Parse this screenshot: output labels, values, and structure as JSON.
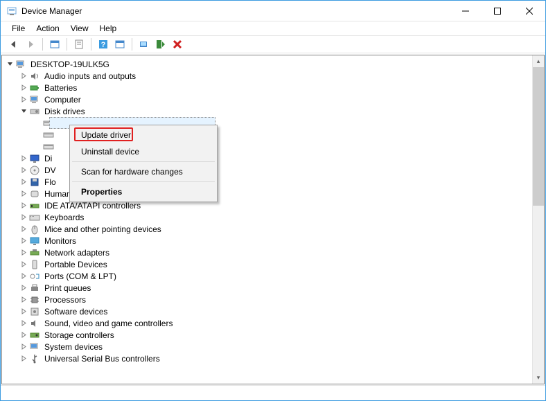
{
  "title": "Device Manager",
  "menubar": [
    "File",
    "Action",
    "View",
    "Help"
  ],
  "toolbar_icons": [
    "back",
    "forward",
    "show-hidden",
    "properties",
    "help",
    "scan",
    "monitor",
    "update",
    "delete"
  ],
  "root": "DESKTOP-19ULK5G",
  "nodes": [
    {
      "label": "Audio inputs and outputs",
      "expanded": false,
      "indent": 1,
      "icon": "audio"
    },
    {
      "label": "Batteries",
      "expanded": false,
      "indent": 1,
      "icon": "battery"
    },
    {
      "label": "Computer",
      "expanded": false,
      "indent": 1,
      "icon": "computer"
    },
    {
      "label": "Disk drives",
      "expanded": true,
      "indent": 1,
      "icon": "disk"
    },
    {
      "label": "",
      "expanded": null,
      "indent": 2,
      "icon": "drive",
      "selected": true
    },
    {
      "label": "",
      "expanded": null,
      "indent": 2,
      "icon": "drive"
    },
    {
      "label": "",
      "expanded": null,
      "indent": 2,
      "icon": "drive"
    },
    {
      "label": "Di",
      "expanded": false,
      "indent": 1,
      "icon": "display"
    },
    {
      "label": "DV",
      "expanded": false,
      "indent": 1,
      "icon": "dvd"
    },
    {
      "label": "Flo",
      "expanded": false,
      "indent": 1,
      "icon": "floppy"
    },
    {
      "label": "Human Interface Devices",
      "expanded": false,
      "indent": 1,
      "icon": "hid"
    },
    {
      "label": "IDE ATA/ATAPI controllers",
      "expanded": false,
      "indent": 1,
      "icon": "ide"
    },
    {
      "label": "Keyboards",
      "expanded": false,
      "indent": 1,
      "icon": "keyboard"
    },
    {
      "label": "Mice and other pointing devices",
      "expanded": false,
      "indent": 1,
      "icon": "mouse"
    },
    {
      "label": "Monitors",
      "expanded": false,
      "indent": 1,
      "icon": "monitor"
    },
    {
      "label": "Network adapters",
      "expanded": false,
      "indent": 1,
      "icon": "network"
    },
    {
      "label": "Portable Devices",
      "expanded": false,
      "indent": 1,
      "icon": "portable"
    },
    {
      "label": "Ports (COM & LPT)",
      "expanded": false,
      "indent": 1,
      "icon": "port"
    },
    {
      "label": "Print queues",
      "expanded": false,
      "indent": 1,
      "icon": "printer"
    },
    {
      "label": "Processors",
      "expanded": false,
      "indent": 1,
      "icon": "cpu"
    },
    {
      "label": "Software devices",
      "expanded": false,
      "indent": 1,
      "icon": "software"
    },
    {
      "label": "Sound, video and game controllers",
      "expanded": false,
      "indent": 1,
      "icon": "sound"
    },
    {
      "label": "Storage controllers",
      "expanded": false,
      "indent": 1,
      "icon": "storage"
    },
    {
      "label": "System devices",
      "expanded": false,
      "indent": 1,
      "icon": "system"
    },
    {
      "label": "Universal Serial Bus controllers",
      "expanded": false,
      "indent": 1,
      "icon": "usb",
      "cut": true
    }
  ],
  "context_menu": {
    "items": [
      {
        "label": "Update driver",
        "highlighted": true
      },
      {
        "label": "Uninstall device"
      },
      {
        "sep": true
      },
      {
        "label": "Scan for hardware changes"
      },
      {
        "sep": true
      },
      {
        "label": "Properties",
        "bold": true
      }
    ]
  }
}
